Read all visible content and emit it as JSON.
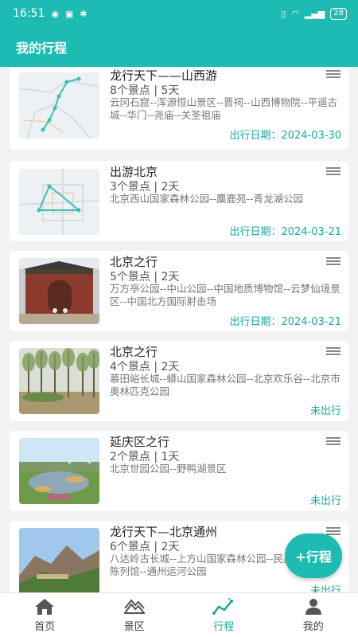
{
  "status_bar": {
    "time": "16:51",
    "battery": "28",
    "icons": [
      "eye-icon",
      "nfc-icon",
      "bluetooth-icon",
      "vibrate-icon",
      "wifi-icon",
      "signal-icon"
    ]
  },
  "header": {
    "title": "我的行程"
  },
  "trips": [
    {
      "title": "龙行天下——山西游",
      "meta": "8个景点 | 5天",
      "route": "云冈石窟--浑源恒山景区--晋祠--山西博物院--平遥古城--华门--尧庙--关圣祖庙",
      "status": "出行日期：2024-03-30",
      "thumb": "map-route-thumbnail"
    },
    {
      "title": "出游北京",
      "meta": "3个景点 | 2天",
      "route": "北京西山国家森林公园--麋鹿苑--青龙湖公园",
      "status": "出行日期：2024-03-21",
      "thumb": "map-route-thumbnail"
    },
    {
      "title": "北京之行",
      "meta": "5个景点 | 2天",
      "route": "万方亭公园--中山公园--中国地质博物馆--云梦仙境景区--中国北方国际射击场",
      "status": "出行日期：2024-03-21",
      "thumb": "temple-gate-photo"
    },
    {
      "title": "北京之行",
      "meta": "4个景点 | 2天",
      "route": "慕田峪长城--蟒山国家森林公园--北京欢乐谷--北京市奥林匹克公园",
      "status": "未出行",
      "thumb": "forest-photo"
    },
    {
      "title": "延庆区之行",
      "meta": "2个景点 | 1天",
      "route": "北京世园公园--野鸭湖景区",
      "status": "未出行",
      "thumb": "garden-photo"
    },
    {
      "title": "龙行天下—北京通州",
      "meta": "6个景点 | 2天",
      "route": "八达岭古长城--上方山国家森林公园--民兵武器装备陈列馆--通州运河公园",
      "status": "未出行",
      "thumb": "mountain-photo"
    }
  ],
  "fab": {
    "label": "+行程"
  },
  "tabs": [
    {
      "label": "首页",
      "icon": "home-icon",
      "active": false
    },
    {
      "label": "景区",
      "icon": "mountain-icon",
      "active": false
    },
    {
      "label": "行程",
      "icon": "route-icon",
      "active": true
    },
    {
      "label": "我的",
      "icon": "user-icon",
      "active": false
    }
  ],
  "colors": {
    "primary": "#1dbbb2",
    "accent_text": "#1aa8a0"
  }
}
